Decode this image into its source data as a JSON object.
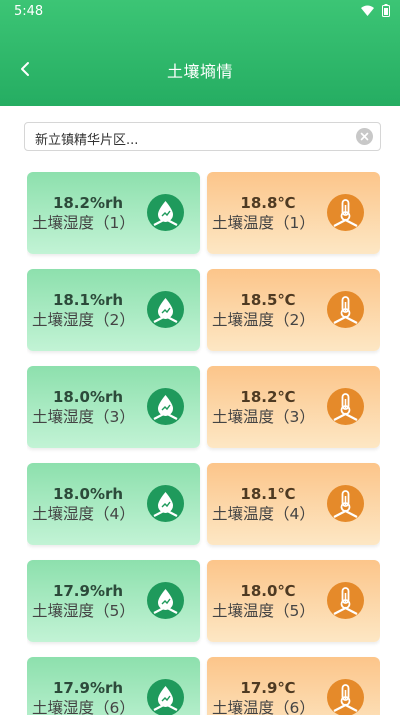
{
  "status_bar": {
    "time": "5:48"
  },
  "header": {
    "title": "土壤墒情"
  },
  "search": {
    "value": "新立镇精华片区..."
  },
  "colors": {
    "header": "#2fb86b",
    "humidity_icon": "#1f9a5c",
    "temperature_icon": "#e58a2a"
  },
  "cards": [
    {
      "humidity": {
        "value": "18.2%rh",
        "label": "土壤湿度（1）"
      },
      "temperature": {
        "value": "18.8℃",
        "label": "土壤温度（1）"
      }
    },
    {
      "humidity": {
        "value": "18.1%rh",
        "label": "土壤湿度（2）"
      },
      "temperature": {
        "value": "18.5℃",
        "label": "土壤温度（2）"
      }
    },
    {
      "humidity": {
        "value": "18.0%rh",
        "label": "土壤湿度（3）"
      },
      "temperature": {
        "value": "18.2℃",
        "label": "土壤温度（3）"
      }
    },
    {
      "humidity": {
        "value": "18.0%rh",
        "label": "土壤湿度（4）"
      },
      "temperature": {
        "value": "18.1℃",
        "label": "土壤温度（4）"
      }
    },
    {
      "humidity": {
        "value": "17.9%rh",
        "label": "土壤湿度（5）"
      },
      "temperature": {
        "value": "18.0℃",
        "label": "土壤温度（5）"
      }
    },
    {
      "humidity": {
        "value": "17.9%rh",
        "label": "土壤湿度（6）"
      },
      "temperature": {
        "value": "17.9℃",
        "label": "土壤温度（6）"
      }
    }
  ]
}
